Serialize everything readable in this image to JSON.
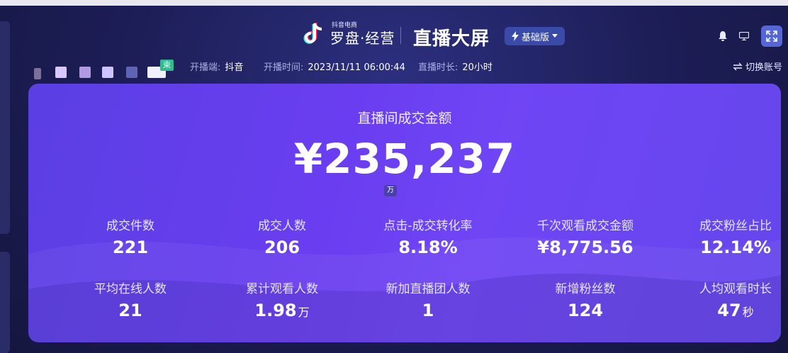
{
  "header": {
    "logo_small": "抖音电商",
    "logo_main": "罗盘·经营",
    "title": "直播大屏",
    "version_label": "基础版"
  },
  "info_bar": {
    "live_tag": "束",
    "platform_label": "开播端:",
    "platform_value": "抖音",
    "start_label": "开播时间:",
    "start_value": "2023/11/11 06:00:44",
    "duration_label": "直播时长:",
    "duration_value": "20小时",
    "switch_account": "切换账号"
  },
  "gmv": {
    "label": "直播间成交金额",
    "value": "¥235,237",
    "unit_badge": "万"
  },
  "metrics_row1": [
    {
      "label": "成交件数",
      "value": "221",
      "unit": ""
    },
    {
      "label": "成交人数",
      "value": "206",
      "unit": ""
    },
    {
      "label": "点击-成交转化率",
      "value": "8.18%",
      "unit": ""
    },
    {
      "label": "千次观看成交金额",
      "value": "¥8,775.56",
      "unit": ""
    },
    {
      "label": "成交粉丝占比",
      "value": "12.14%",
      "unit": ""
    }
  ],
  "metrics_row2": [
    {
      "label": "平均在线人数",
      "value": "21",
      "unit": ""
    },
    {
      "label": "累计观看人数",
      "value": "1.98",
      "unit": "万"
    },
    {
      "label": "新加直播团人数",
      "value": "1",
      "unit": ""
    },
    {
      "label": "新增粉丝数",
      "value": "124",
      "unit": ""
    },
    {
      "label": "人均观看时长",
      "value": "47",
      "unit": "秒"
    }
  ],
  "colors": {
    "card_start": "#5a3fe3",
    "card_end": "#6546ec",
    "background": "#1c1d55",
    "accent_button": "#5566d8",
    "live_tag": "#35b88e"
  },
  "icons": {
    "logo": "tiktok-note-icon",
    "version": "lightning-icon",
    "bell": "bell-icon",
    "monitor": "monitor-icon",
    "expand": "fullscreen-icon",
    "switch": "switch-arrows-icon"
  }
}
